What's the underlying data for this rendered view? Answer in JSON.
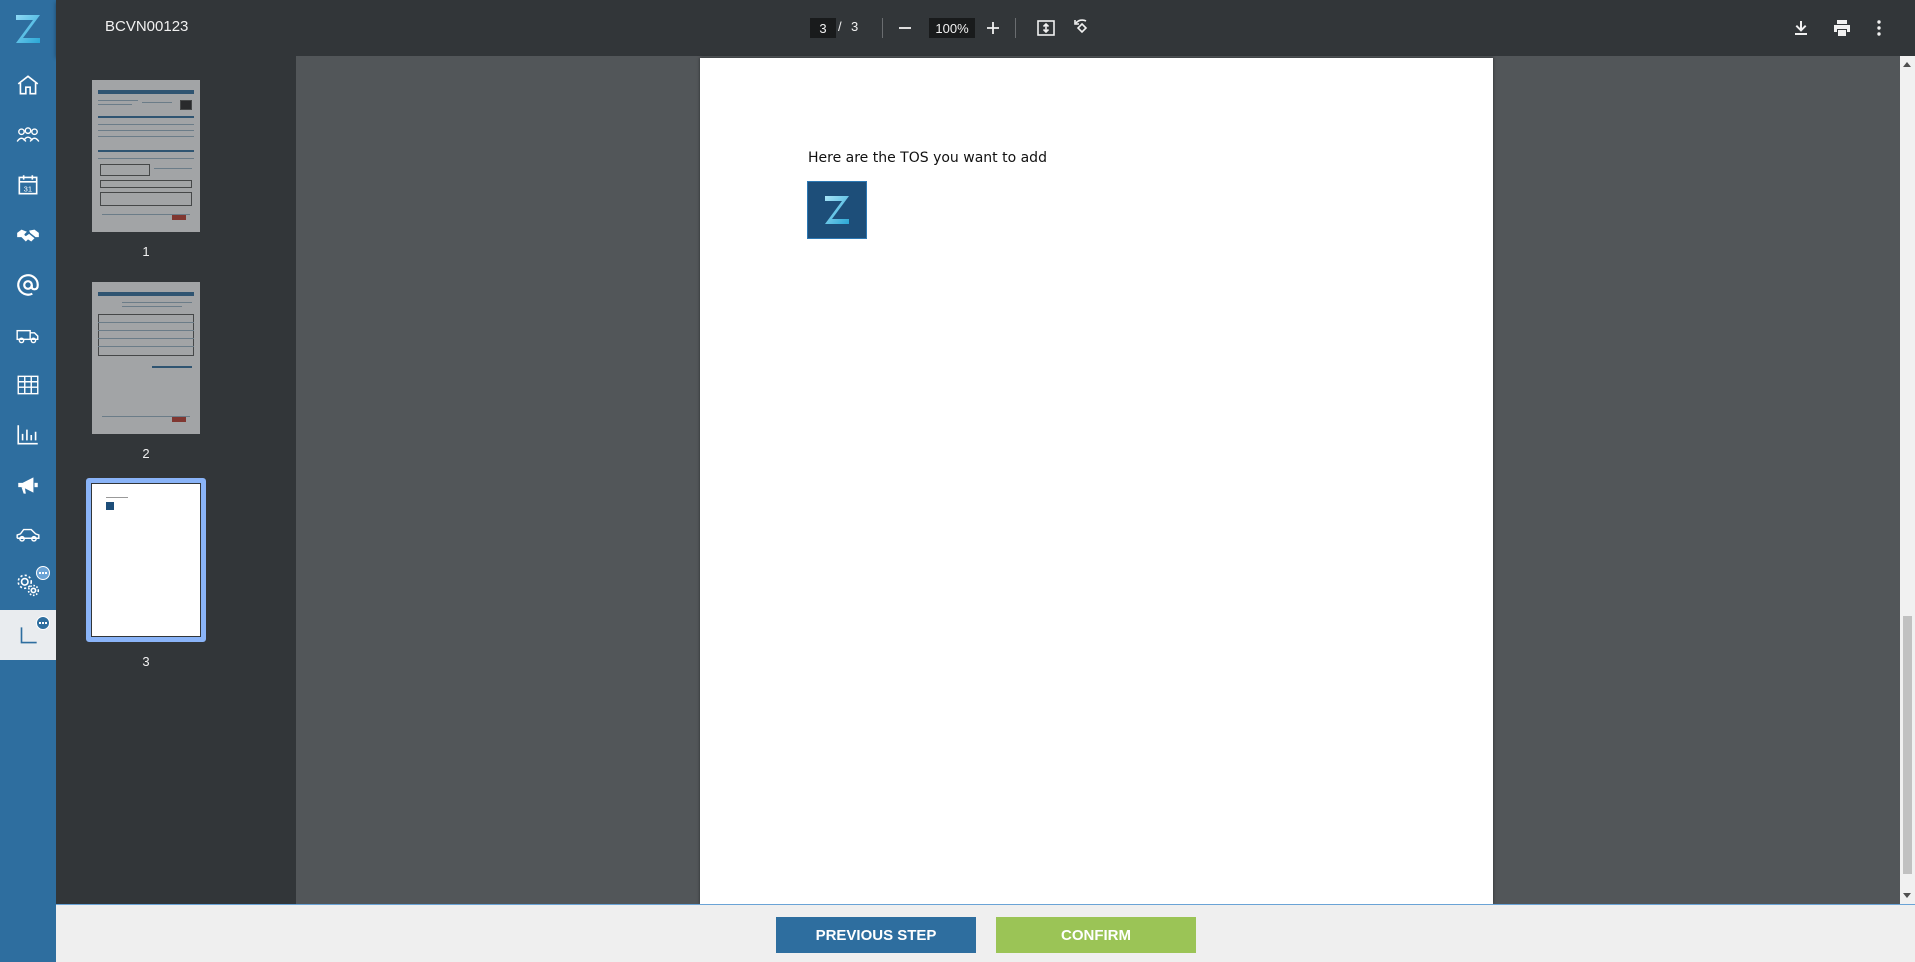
{
  "app": {
    "rail_items": [
      {
        "name": "home"
      },
      {
        "name": "contacts"
      },
      {
        "name": "calendar"
      },
      {
        "name": "deals"
      },
      {
        "name": "email"
      },
      {
        "name": "logistics"
      },
      {
        "name": "spreadsheet"
      },
      {
        "name": "reports"
      },
      {
        "name": "marketing"
      },
      {
        "name": "vehicles"
      },
      {
        "name": "settings"
      },
      {
        "name": "documents"
      }
    ],
    "colors": {
      "rail": "#2e6e9f",
      "accent": "#8ab4f8",
      "confirm": "#9bc456"
    }
  },
  "toolbar": {
    "title": "BCVN00123",
    "page_current": "3",
    "page_separator": "/",
    "page_total": "3",
    "zoom": "100%"
  },
  "thumbnails": [
    {
      "number": "1"
    },
    {
      "number": "2"
    },
    {
      "number": "3",
      "selected": true
    }
  ],
  "document": {
    "text": "Here are the TOS you want to add"
  },
  "actions": {
    "previous_label": "PREVIOUS STEP",
    "confirm_label": "CONFIRM"
  }
}
